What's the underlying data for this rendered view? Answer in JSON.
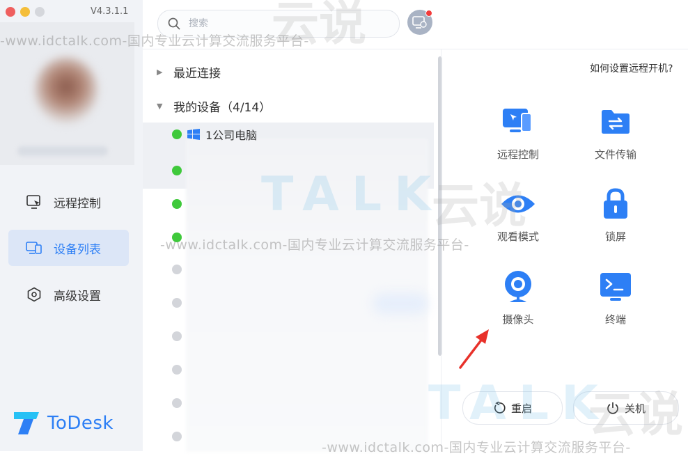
{
  "window": {
    "version": "V4.3.1.1",
    "traffic_colors": [
      "#ef5f5f",
      "#f4be3a",
      "#d5d7dc"
    ]
  },
  "search": {
    "placeholder": "搜索"
  },
  "sidebar": {
    "items": [
      {
        "label": "远程控制",
        "icon": "remote-control-icon",
        "active": false
      },
      {
        "label": "设备列表",
        "icon": "device-list-icon",
        "active": true
      },
      {
        "label": "高级设置",
        "icon": "settings-hexagon-icon",
        "active": false
      }
    ],
    "brand": "ToDesk"
  },
  "device_list": {
    "recent_group": "最近连接",
    "my_devices_group": "我的设备（4/14）",
    "devices": [
      {
        "name": "1公司电脑",
        "status": "online",
        "os": "windows"
      },
      {
        "name": "",
        "status": "online"
      },
      {
        "name": "",
        "status": "online"
      },
      {
        "name": "",
        "status": "online"
      },
      {
        "name": "",
        "status": "offline"
      },
      {
        "name": "",
        "status": "offline"
      },
      {
        "name": "",
        "status": "offline"
      },
      {
        "name": "",
        "status": "offline"
      },
      {
        "name": "",
        "status": "offline"
      },
      {
        "name": "",
        "status": "offline"
      }
    ]
  },
  "actions": {
    "help_link": "如何设置远程开机?",
    "items": [
      {
        "label": "远程控制",
        "icon": "remote-control-icon"
      },
      {
        "label": "文件传输",
        "icon": "file-transfer-icon"
      },
      {
        "label": "观看模式",
        "icon": "eye-icon"
      },
      {
        "label": "锁屏",
        "icon": "lock-icon"
      },
      {
        "label": "摄像头",
        "icon": "camera-icon"
      },
      {
        "label": "终端",
        "icon": "terminal-icon"
      }
    ],
    "restart": "重启",
    "shutdown": "关机"
  },
  "watermark": {
    "text": "-www.idctalk.com-国内专业云计算交流服务平台-",
    "logo": "TALK",
    "cjk": "云说"
  },
  "colors": {
    "accent": "#2d7ff5",
    "online": "#3fc93b",
    "offline": "#d3d5da",
    "annotation_arrow": "#e8312a"
  }
}
